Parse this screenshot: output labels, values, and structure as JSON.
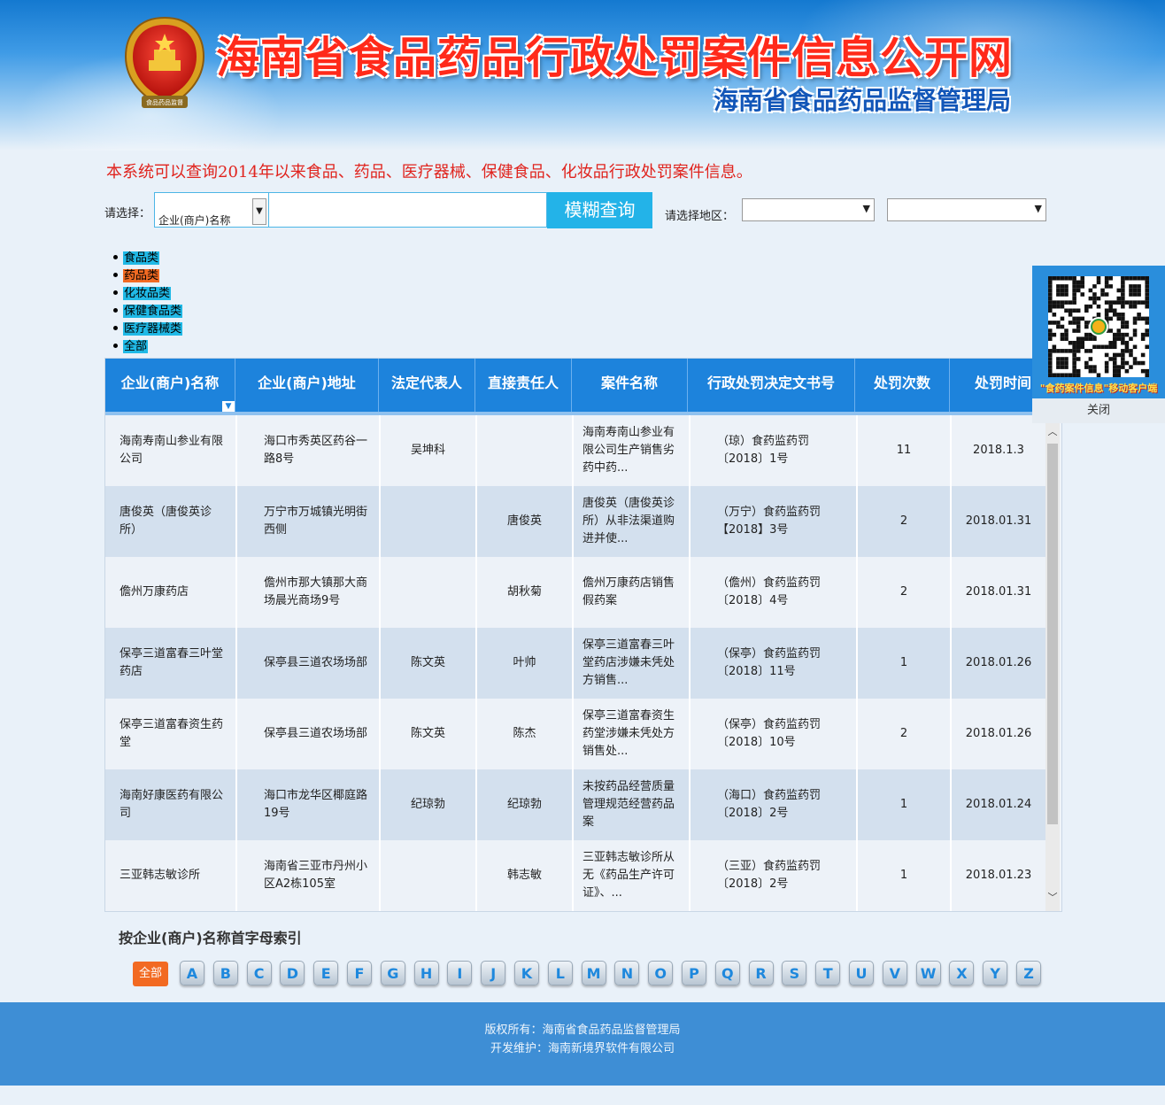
{
  "header": {
    "title": "海南省食品药品行政处罚案件信息公开网",
    "subtitle": "海南省食品药品监督管理局",
    "emblem_text": "食品药品监督"
  },
  "intro": "本系统可以查询2014年以来食品、药品、医疗器械、保健食品、化妆品行政处罚案件信息。",
  "search": {
    "label": "请选择：",
    "select_value": "企业(商户)名称",
    "input_value": "",
    "button": "模糊查询",
    "region_label": "请选择地区：",
    "region1": "",
    "region2": ""
  },
  "categories": [
    {
      "label": "食品类",
      "active": false
    },
    {
      "label": "药品类",
      "active": true
    },
    {
      "label": "化妆品类",
      "active": false
    },
    {
      "label": "保健食品类",
      "active": false
    },
    {
      "label": "医疗器械类",
      "active": false
    },
    {
      "label": "全部",
      "active": false
    }
  ],
  "table": {
    "headers": [
      "企业(商户)名称",
      "企业(商户)地址",
      "法定代表人",
      "直接责任人",
      "案件名称",
      "行政处罚决定文书号",
      "处罚次数",
      "处罚时间"
    ],
    "rows": [
      [
        "海南寿南山参业有限公司",
        "海口市秀英区药谷一路8号",
        "吴坤科",
        "",
        "海南寿南山参业有限公司生产销售劣药中药...",
        "（琼）食药监药罚〔2018〕1号",
        "11",
        "2018.1.3"
      ],
      [
        "唐俊英（唐俊英诊所）",
        "万宁市万城镇光明街西侧",
        "",
        "唐俊英",
        "唐俊英（唐俊英诊所）从非法渠道购进并使...",
        "（万宁）食药监药罚【2018】3号",
        "2",
        "2018.01.31"
      ],
      [
        "儋州万康药店",
        "儋州市那大镇那大商场晨光商场9号",
        "",
        "胡秋菊",
        "儋州万康药店销售假药案",
        "（儋州）食药监药罚〔2018〕4号",
        "2",
        "2018.01.31"
      ],
      [
        "保亭三道富春三叶堂药店",
        "保亭县三道农场场部",
        "陈文英",
        "叶帅",
        "保亭三道富春三叶堂药店涉嫌未凭处方销售...",
        "（保亭）食药监药罚〔2018〕11号",
        "1",
        "2018.01.26"
      ],
      [
        "保亭三道富春资生药堂",
        "保亭县三道农场场部",
        "陈文英",
        "陈杰",
        "保亭三道富春资生药堂涉嫌未凭处方销售处...",
        "（保亭）食药监药罚〔2018〕10号",
        "2",
        "2018.01.26"
      ],
      [
        "海南好康医药有限公司",
        "海口市龙华区椰庭路19号",
        "纪琼勃",
        "纪琼勃",
        "未按药品经营质量管理规范经营药品案",
        "（海口）食药监药罚〔2018〕2号",
        "1",
        "2018.01.24"
      ],
      [
        "三亚韩志敏诊所",
        "海南省三亚市丹州小区A2栋105室",
        "",
        "韩志敏",
        "三亚韩志敏诊所从无《药品生产许可证》、...",
        "（三亚）食药监药罚〔2018〕2号",
        "1",
        "2018.01.23"
      ]
    ]
  },
  "index": {
    "title": "按企业(商户)名称首字母索引",
    "all_label": "全部",
    "letters": [
      "A",
      "B",
      "C",
      "D",
      "E",
      "F",
      "G",
      "H",
      "I",
      "J",
      "K",
      "L",
      "M",
      "N",
      "O",
      "P",
      "Q",
      "R",
      "S",
      "T",
      "U",
      "V",
      "W",
      "X",
      "Y",
      "Z"
    ]
  },
  "footer": {
    "copyright": "版权所有：海南省食品药品监督管理局",
    "developer": "开发维护：海南新境界软件有限公司"
  },
  "qr": {
    "caption": "\"食药案件信息\"移动客户端",
    "close": "关闭"
  },
  "colors": {
    "header_blue": "#1d83dc",
    "search_button": "#23b3e8",
    "category_bg": "#20b9e6",
    "category_active": "#f26a22",
    "title_red": "#ff2a1a",
    "footer": "#3e8ed5"
  },
  "icons": {
    "emblem": "national-emblem-icon",
    "sort": "sort-down-icon",
    "dropdown": "chevron-down-icon"
  }
}
